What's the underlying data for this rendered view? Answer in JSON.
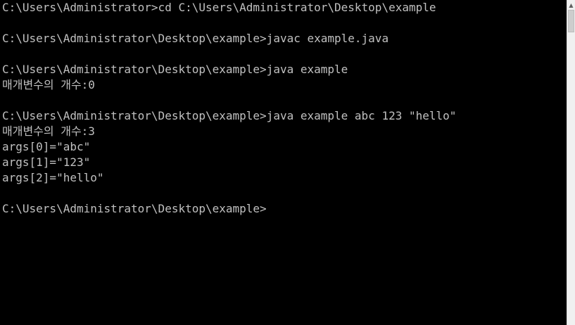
{
  "console": {
    "lines": [
      "C:\\Users\\Administrator>cd C:\\Users\\Administrator\\Desktop\\example",
      "",
      "C:\\Users\\Administrator\\Desktop\\example>javac example.java",
      "",
      "C:\\Users\\Administrator\\Desktop\\example>java example",
      "매개변수의 개수:0",
      "",
      "C:\\Users\\Administrator\\Desktop\\example>java example abc 123 \"hello\"",
      "매개변수의 개수:3",
      "args[0]=\"abc\"",
      "args[1]=\"123\"",
      "args[2]=\"hello\"",
      "",
      "C:\\Users\\Administrator\\Desktop\\example>"
    ]
  },
  "scrollbar": {
    "up_icon": "chevron-up-icon"
  },
  "colors": {
    "background": "#000000",
    "text": "#c0c0c0",
    "scrollbar_track": "#f0f0f0",
    "scrollbar_thumb": "#cdcdcd"
  }
}
